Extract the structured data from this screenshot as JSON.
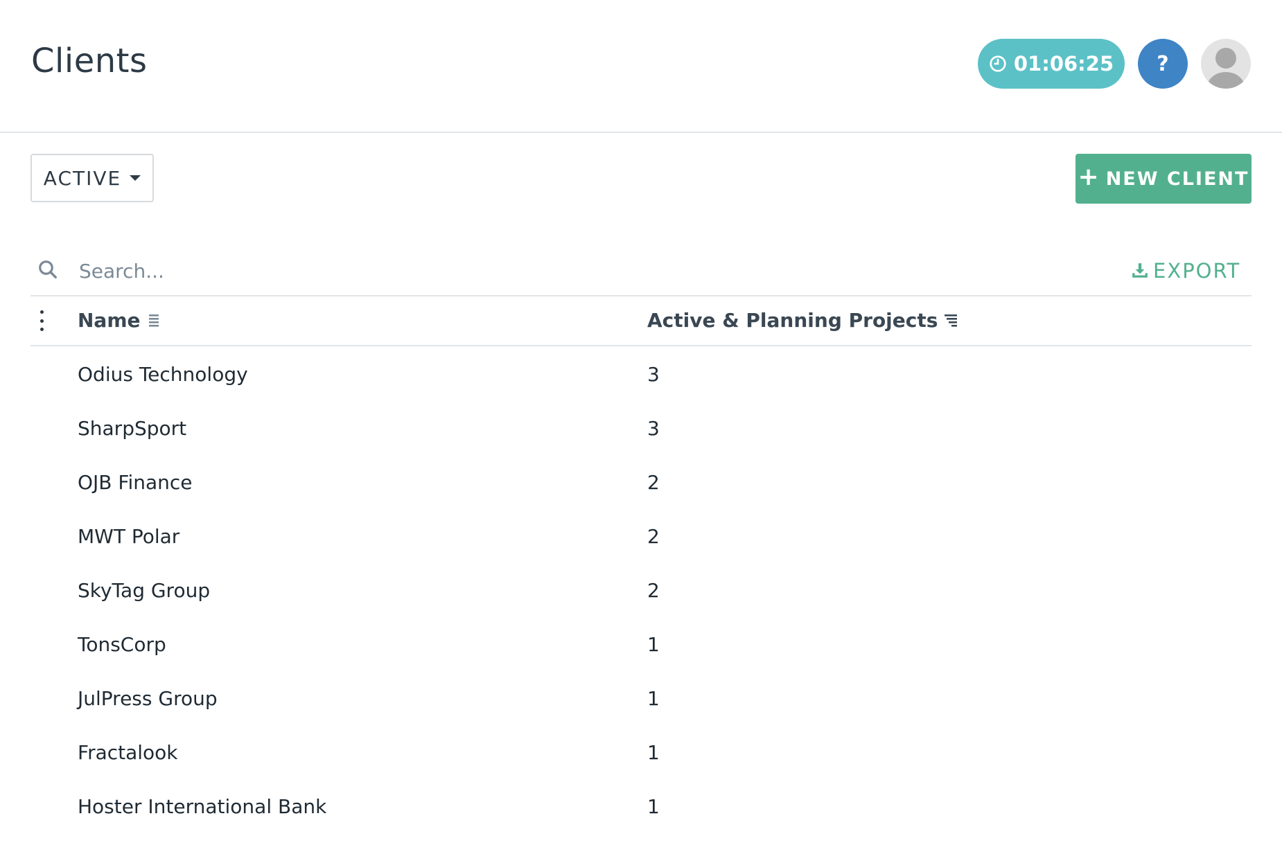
{
  "header": {
    "title": "Clients",
    "timer": "01:06:25",
    "help_label": "?"
  },
  "toolbar": {
    "status_filter": "ACTIVE",
    "new_client_label": "NEW CLIENT"
  },
  "search": {
    "placeholder": "Search...",
    "value": "",
    "export_label": "EXPORT"
  },
  "table": {
    "columns": [
      "Name",
      "Active & Planning Projects"
    ],
    "rows": [
      {
        "name": "Odius Technology",
        "projects": "3"
      },
      {
        "name": "SharpSport",
        "projects": "3"
      },
      {
        "name": "OJB Finance",
        "projects": "2"
      },
      {
        "name": "MWT Polar",
        "projects": "2"
      },
      {
        "name": "SkyTag Group",
        "projects": "2"
      },
      {
        "name": "TonsCorp",
        "projects": "1"
      },
      {
        "name": "JulPress Group",
        "projects": "1"
      },
      {
        "name": "Fractalook",
        "projects": "1"
      },
      {
        "name": "Hoster International Bank",
        "projects": "1"
      }
    ]
  },
  "colors": {
    "timer_bg": "#5bc1c6",
    "help_bg": "#3f84c5",
    "accent_green": "#53b08e",
    "text": "#2d3a45"
  },
  "icons": [
    "clock-icon",
    "question-icon",
    "user-avatar-icon",
    "caret-down-icon",
    "plus-icon",
    "search-icon",
    "download-icon",
    "kebab-menu-icon",
    "sort-icon",
    "sort-descending-icon"
  ]
}
